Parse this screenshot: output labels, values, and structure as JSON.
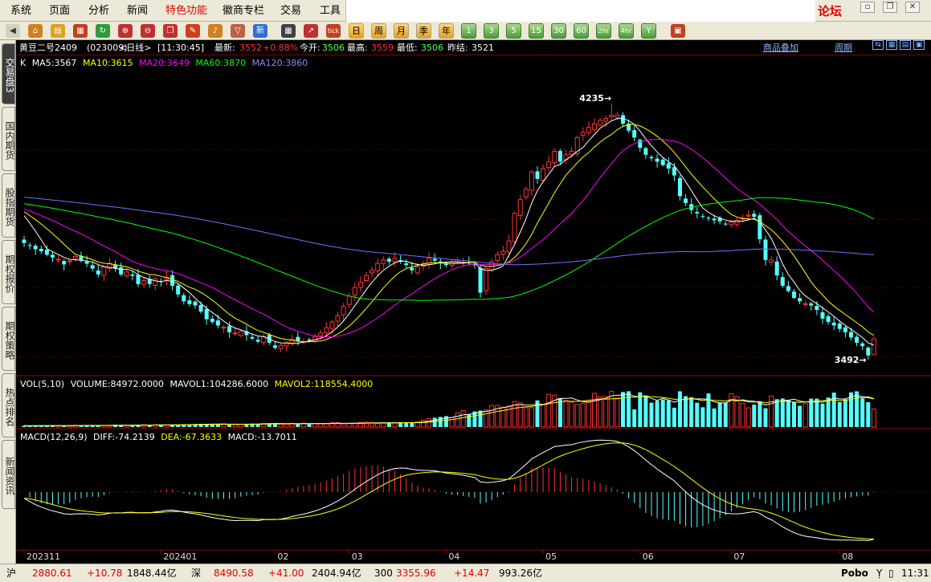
{
  "menu": {
    "items": [
      "系统",
      "页面",
      "分析",
      "新闻",
      "特色功能",
      "徽商专栏",
      "交易",
      "工具"
    ],
    "active_index": 4,
    "logo": "论坛"
  },
  "window_controls": [
    "▫",
    "❐",
    "✕"
  ],
  "toolbar": {
    "icons": [
      "back-arrow",
      "home",
      "folder",
      "calendar",
      "refresh",
      "zoom-in",
      "zoom-out",
      "windows",
      "pen",
      "bell",
      "filter",
      "news"
    ],
    "news_label": "新",
    "grid_icon": "table",
    "stats_icon": "stock-chart",
    "tick_label": "tick",
    "periods": [
      "日",
      "周",
      "月",
      "季",
      "年",
      "1",
      "3",
      "5",
      "15",
      "30",
      "60",
      "2hr",
      "4hr",
      "Y"
    ],
    "active_period": "日",
    "trailing_icon": "panel"
  },
  "left_tabs": [
    {
      "label": "交易盘3",
      "active": true
    },
    {
      "label": "国内期货",
      "active": false
    },
    {
      "label": "股指期货",
      "active": false
    },
    {
      "label": "期权报价",
      "active": false
    },
    {
      "label": "期权策略",
      "active": false
    },
    {
      "label": "热点排名",
      "active": false
    },
    {
      "label": "新闻资讯",
      "active": false
    }
  ],
  "quote": {
    "name": "黄豆二号2409",
    "code": "(023009)",
    "period": "<日线>",
    "time": "[11:30:45]",
    "latest_label": "最新:",
    "latest": "3552",
    "change_pct": "+0.88%",
    "open_label": "今开:",
    "open": "3506",
    "high_label": "最高:",
    "high": "3559",
    "low_label": "最低:",
    "low": "3506",
    "prev_label": "昨结:",
    "prev": "3521",
    "overlay_link": "商品叠加",
    "period_link": "周期"
  },
  "kline": {
    "label": "K",
    "ma": [
      {
        "text": "MA5:3567",
        "color": "#ffffff"
      },
      {
        "text": "MA10:3615",
        "color": "#ffff00"
      },
      {
        "text": "MA20:3649",
        "color": "#ff00ff"
      },
      {
        "text": "MA60:3870",
        "color": "#00ff00"
      },
      {
        "text": "MA120:3860",
        "color": "#7070ff"
      }
    ],
    "high_mark": "4235",
    "low_mark": "3492",
    "up_color": "#ff3232",
    "down_color": "#54ffff"
  },
  "volume": {
    "legend": "VOL(5,10)",
    "volume_text": "VOLUME:84972.0000",
    "mavol1_text": "MAVOL1:104286.6000",
    "mavol2_text": "MAVOL2:118554.4000"
  },
  "macd": {
    "legend": "MACD(12,26,9)",
    "diff_text": "DIFF:-74.2139",
    "dea_text": "DEA:-67.3633",
    "macd_text": "MACD:-13.7011"
  },
  "x_axis_labels": [
    "202311",
    "202401",
    "02",
    "03",
    "04",
    "05",
    "06",
    "07",
    "08"
  ],
  "status": {
    "sh_label": "沪",
    "sh_value": "2880.61",
    "sh_change": "+10.78",
    "sh_amount": "1848.44亿",
    "sz_label": "深",
    "sz_value": "8490.58",
    "sz_change": "+41.00",
    "sz_amount": "2404.94亿",
    "i300_label": "300",
    "i300_value": "3355.96",
    "i300_change": "+14.47",
    "i300_amount": "993.26亿",
    "brand": "Pobo",
    "time": "11:31"
  },
  "chart_data": [
    {
      "type": "candlestick",
      "title": "黄豆二号2409 (023009) 日线",
      "x_ticks": [
        "202311",
        "202401",
        "02",
        "03",
        "04",
        "05",
        "06",
        "07",
        "08"
      ],
      "ylim": [
        3450,
        4330
      ],
      "gridlines": [
        3500,
        3700,
        3900,
        4100
      ],
      "close": [
        3830,
        3822,
        3812,
        3806,
        3796,
        3788,
        3783,
        3768,
        3778,
        3791,
        3781,
        3770,
        3756,
        3739,
        3761,
        3771,
        3756,
        3739,
        3746,
        3735,
        3711,
        3721,
        3711,
        3726,
        3719,
        3731,
        3706,
        3681,
        3661,
        3653,
        3649,
        3631,
        3609,
        3601,
        3591,
        3586,
        3571,
        3569,
        3574,
        3563,
        3553,
        3544,
        3559,
        3541,
        3526,
        3533,
        3541,
        3551,
        3546,
        3544,
        3549,
        3559,
        3569,
        3584,
        3601,
        3619,
        3646,
        3676,
        3701,
        3716,
        3736,
        3751,
        3771,
        3781,
        3776,
        3786,
        3776,
        3766,
        3751,
        3761,
        3771,
        3786,
        3779,
        3771,
        3766,
        3776,
        3781,
        3774,
        3771,
        3766,
        3686,
        3756,
        3776,
        3796,
        3806,
        3836,
        3916,
        3956,
        3986,
        4036,
        4016,
        4046,
        4066,
        4096,
        4066,
        4086,
        4096,
        4136,
        4151,
        4166,
        4176,
        4186,
        4191,
        4201,
        4201,
        4176,
        4156,
        4136,
        4106,
        4086,
        4076,
        4066,
        4056,
        4046,
        4026,
        3966,
        3946,
        3926,
        3916,
        3906,
        3901,
        3896,
        3893,
        3886,
        3891,
        3896,
        3902,
        3911,
        3906,
        3841,
        3781,
        3781,
        3736,
        3706,
        3691,
        3671,
        3661,
        3654,
        3649,
        3636,
        3611,
        3601,
        3591,
        3581,
        3571,
        3556,
        3541,
        3531,
        3504,
        3537
      ],
      "ma5": 3567,
      "ma10": 3615,
      "ma20": 3649,
      "ma60": 3870,
      "ma120": 3860,
      "high_mark": 4235,
      "low_mark": 3492
    },
    {
      "type": "bar",
      "title": "VOL(5,10)",
      "volume": 84972.0,
      "mavol1": 104286.6,
      "mavol2": 118554.4,
      "ylim": [
        0,
        190000
      ]
    },
    {
      "type": "bar+line",
      "title": "MACD(12,26,9)",
      "diff": -74.2139,
      "dea": -67.3633,
      "macd": -13.7011
    }
  ]
}
